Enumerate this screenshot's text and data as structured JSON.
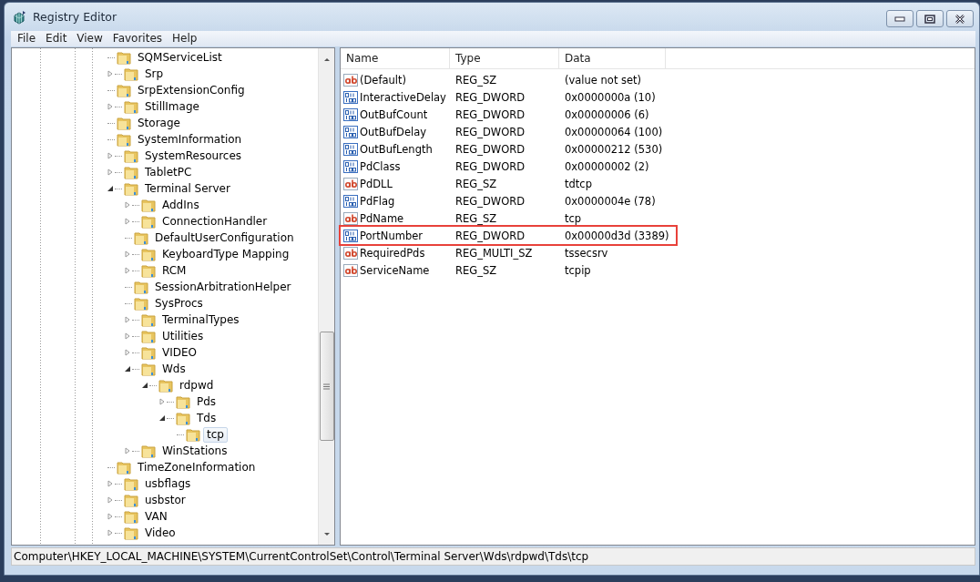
{
  "window": {
    "title": "Registry Editor"
  },
  "menu": [
    "File",
    "Edit",
    "View",
    "Favorites",
    "Help"
  ],
  "tree": [
    {
      "label": "SQMServiceList",
      "selected": false
    },
    {
      "label": "Srp",
      "expanded": false,
      "selected": false
    },
    {
      "label": "SrpExtensionConfig",
      "selected": false
    },
    {
      "label": "StillImage",
      "expanded": false,
      "selected": false
    },
    {
      "label": "Storage",
      "selected": false
    },
    {
      "label": "SystemInformation",
      "selected": false
    },
    {
      "label": "SystemResources",
      "expanded": false,
      "selected": false
    },
    {
      "label": "TabletPC",
      "expanded": false,
      "selected": false
    },
    {
      "label": "Terminal Server",
      "expanded": true,
      "selected": false,
      "children": [
        {
          "label": "AddIns",
          "expanded": false,
          "selected": false
        },
        {
          "label": "ConnectionHandler",
          "expanded": false,
          "selected": false
        },
        {
          "label": "DefaultUserConfiguration",
          "selected": false
        },
        {
          "label": "KeyboardType Mapping",
          "expanded": false,
          "selected": false
        },
        {
          "label": "RCM",
          "expanded": false,
          "selected": false
        },
        {
          "label": "SessionArbitrationHelper",
          "selected": false
        },
        {
          "label": "SysProcs",
          "selected": false
        },
        {
          "label": "TerminalTypes",
          "expanded": false,
          "selected": false
        },
        {
          "label": "Utilities",
          "expanded": false,
          "selected": false
        },
        {
          "label": "VIDEO",
          "expanded": false,
          "selected": false
        },
        {
          "label": "Wds",
          "expanded": true,
          "selected": false,
          "children": [
            {
              "label": "rdpwd",
              "expanded": true,
              "selected": false,
              "children": [
                {
                  "label": "Pds",
                  "expanded": false,
                  "selected": false
                },
                {
                  "label": "Tds",
                  "expanded": true,
                  "selected": false,
                  "children": [
                    {
                      "label": "tcp",
                      "selected": true
                    }
                  ]
                }
              ]
            }
          ]
        },
        {
          "label": "WinStations",
          "expanded": false,
          "selected": false
        }
      ]
    },
    {
      "label": "TimeZoneInformation",
      "selected": false
    },
    {
      "label": "usbflags",
      "expanded": false,
      "selected": false
    },
    {
      "label": "usbstor",
      "expanded": false,
      "selected": false
    },
    {
      "label": "VAN",
      "expanded": false,
      "selected": false
    },
    {
      "label": "Video",
      "expanded": false,
      "selected": false
    }
  ],
  "table": {
    "columns": [
      "Name",
      "Type",
      "Data"
    ],
    "rows": [
      {
        "kind": "text",
        "name": "(Default)",
        "type": "REG_SZ",
        "data": "(value not set)",
        "highlighted": false
      },
      {
        "kind": "number",
        "name": "InteractiveDelay",
        "type": "REG_DWORD",
        "data": "0x0000000a (10)",
        "highlighted": false
      },
      {
        "kind": "number",
        "name": "OutBufCount",
        "type": "REG_DWORD",
        "data": "0x00000006 (6)",
        "highlighted": false
      },
      {
        "kind": "number",
        "name": "OutBufDelay",
        "type": "REG_DWORD",
        "data": "0x00000064 (100)",
        "highlighted": false
      },
      {
        "kind": "number",
        "name": "OutBufLength",
        "type": "REG_DWORD",
        "data": "0x00000212 (530)",
        "highlighted": false
      },
      {
        "kind": "number",
        "name": "PdClass",
        "type": "REG_DWORD",
        "data": "0x00000002 (2)",
        "highlighted": false
      },
      {
        "kind": "text",
        "name": "PdDLL",
        "type": "REG_SZ",
        "data": "tdtcp",
        "highlighted": false
      },
      {
        "kind": "number",
        "name": "PdFlag",
        "type": "REG_DWORD",
        "data": "0x0000004e (78)",
        "highlighted": false
      },
      {
        "kind": "text",
        "name": "PdName",
        "type": "REG_SZ",
        "data": "tcp",
        "highlighted": false
      },
      {
        "kind": "number",
        "name": "PortNumber",
        "type": "REG_DWORD",
        "data": "0x00000d3d (3389)",
        "highlighted": true
      },
      {
        "kind": "text",
        "name": "RequiredPds",
        "type": "REG_MULTI_SZ",
        "data": "tssecsrv",
        "highlighted": false
      },
      {
        "kind": "text",
        "name": "ServiceName",
        "type": "REG_SZ",
        "data": "tcpip",
        "highlighted": false
      }
    ]
  },
  "status_bar": "Computer\\HKEY_LOCAL_MACHINE\\SYSTEM\\CurrentControlSet\\Control\\Terminal Server\\Wds\\rdpwd\\Tds\\tcp"
}
